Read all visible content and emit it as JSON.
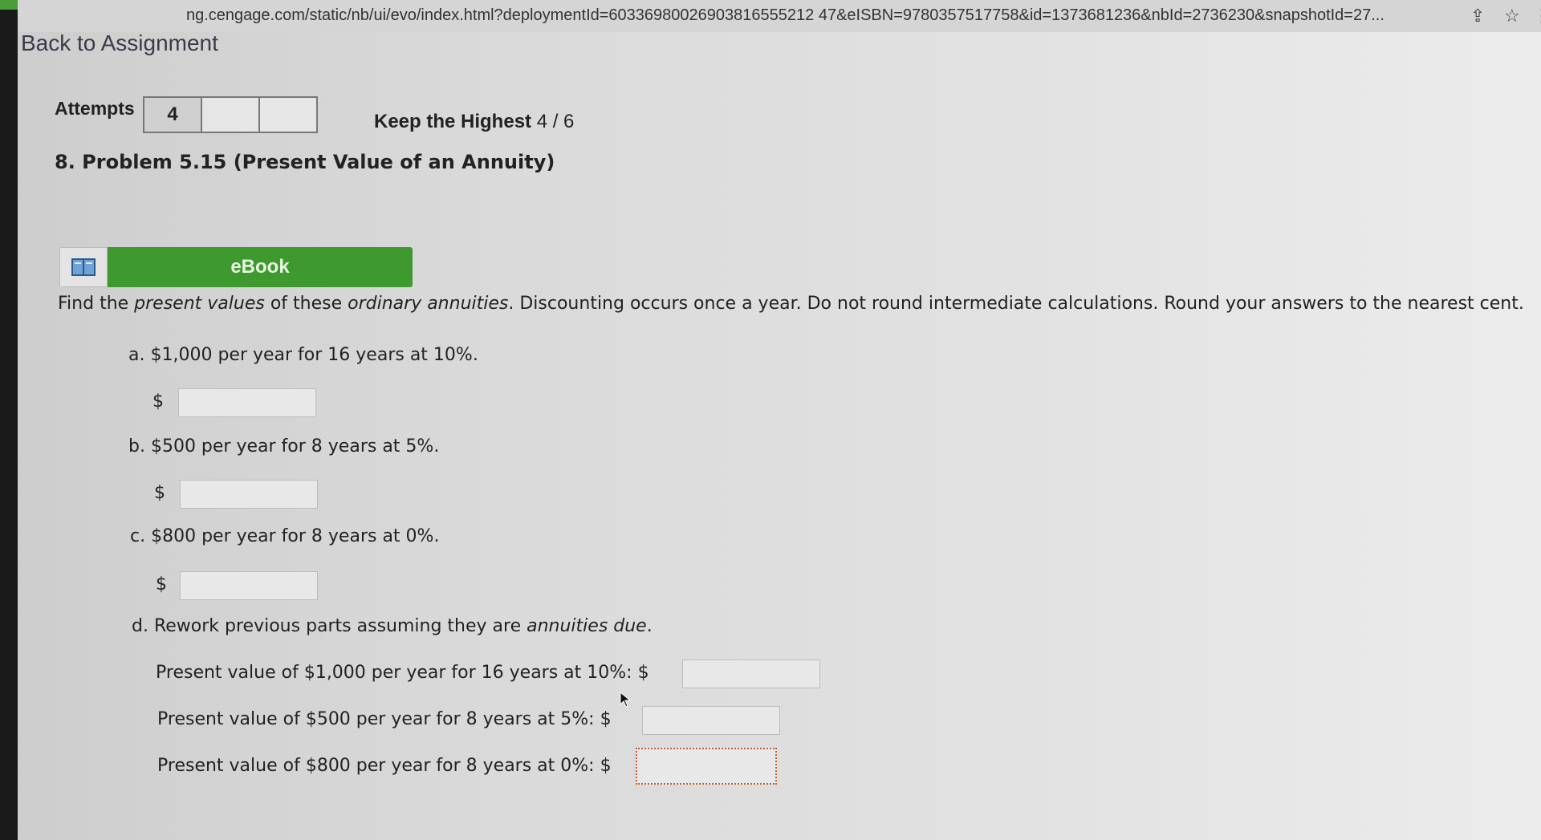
{
  "browser": {
    "url": "ng.cengage.com/static/nb/ui/evo/index.html?deploymentId=60336980026903816555212 47&eISBN=9780357517758&id=1373681236&nbId=2736230&snapshotId=27..."
  },
  "nav": {
    "back_label": "Back to Assignment"
  },
  "attempts": {
    "label": "Attempts",
    "boxes": [
      "4",
      "",
      ""
    ],
    "keep_label": "Keep the Highest",
    "keep_value": "4 / 6"
  },
  "problem": {
    "title": "8.  Problem 5.15 (Present Value of an Annuity)",
    "ebook_label": "eBook",
    "instructions_pre": "Find the ",
    "instructions_em1": "present values",
    "instructions_mid1": " of these ",
    "instructions_em2": "ordinary annuities",
    "instructions_post": ". Discounting occurs once a year. Do not round intermediate calculations. Round your answers to the nearest cent.",
    "parts": {
      "a": "a. $1,000 per year for 16 years at 10%.",
      "b": "b. $500 per year for 8 years at 5%.",
      "c": "c. $800 per year for 8 years at 0%.",
      "d_pre": "d. Rework previous parts assuming they are ",
      "d_em": "annuities due",
      "d_post": "."
    },
    "d_lines": [
      "Present value of $1,000 per year for 16 years at 10%: $",
      "Present value of $500 per year for 8 years at 5%: $",
      "Present value of $800 per year for 8 years at 0%: $"
    ],
    "currency_symbol": "$",
    "answers": {
      "a": "",
      "b": "",
      "c": "",
      "d1": "",
      "d2": "",
      "d3": ""
    }
  },
  "colors": {
    "ebook_green": "#3e9a2e",
    "focus_outline": "#c0622a"
  },
  "icons": {
    "ebook": "book-icon",
    "share": "share-icon",
    "star": "star-icon",
    "menu": "kebab-menu-icon"
  }
}
